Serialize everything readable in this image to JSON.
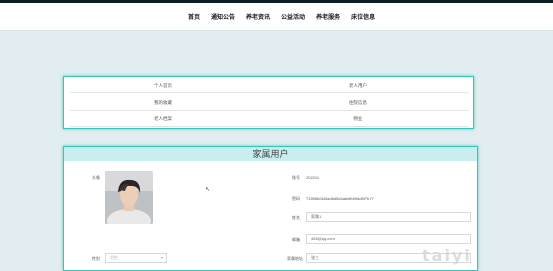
{
  "nav": {
    "items": [
      "首页",
      "通知公告",
      "养老资讯",
      "公益活动",
      "养老服务",
      "床位信息"
    ]
  },
  "menu": {
    "left": [
      "个人首页",
      "我的收藏",
      "老人档案"
    ],
    "right": [
      "老人用户",
      "住院信息",
      "物业"
    ]
  },
  "profile": {
    "title": "家属用户",
    "avatar_label": "头像",
    "account_label": "账号",
    "account_value": "202211",
    "password_label": "密码",
    "password_value": "7155f8d3d3ad8d5d4abdffd0fdd5f7b77",
    "name_label": "姓名",
    "name_value": "家属1",
    "email_label": "邮箱",
    "email_value": "456@qq.com",
    "gender_label": "性别",
    "gender_value": "男性",
    "relation_label": "家属地址",
    "relation_value": "张三"
  },
  "watermark": "taiyi",
  "colors": {
    "accent": "#34c6b8",
    "header_bg": "#c9eef0",
    "page_bg": "#e2edf1"
  }
}
